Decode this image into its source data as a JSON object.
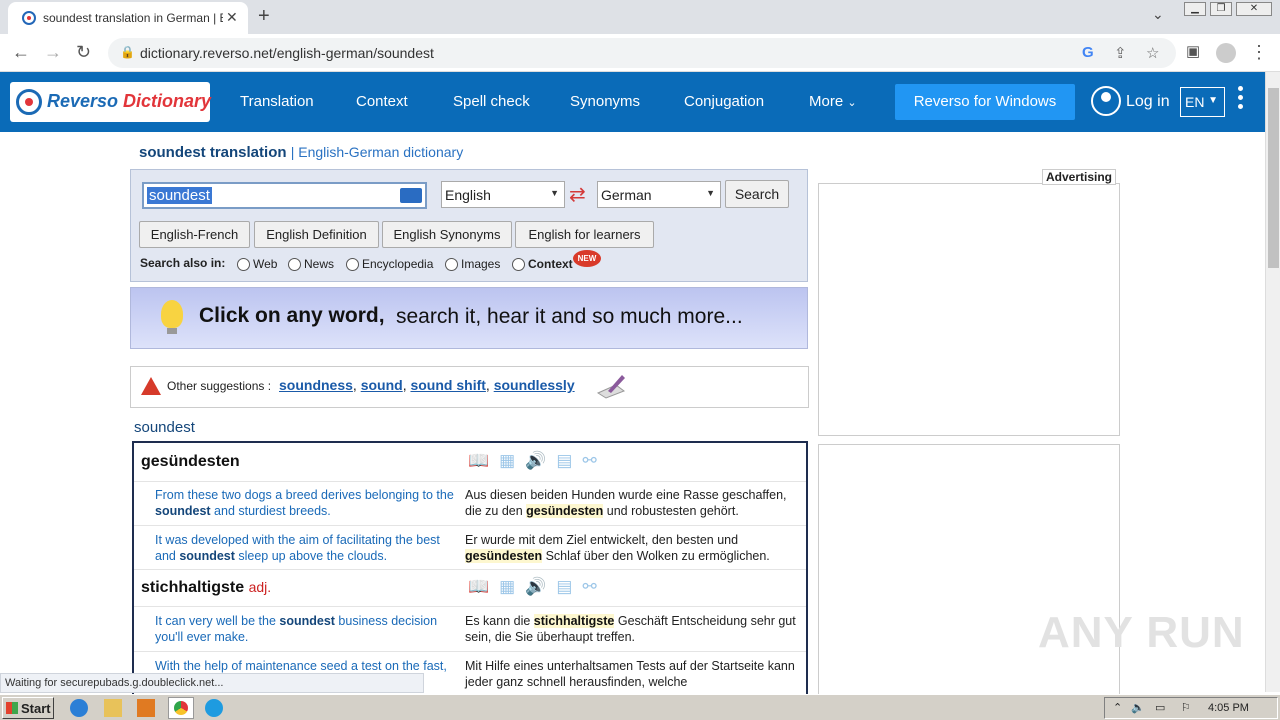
{
  "browser": {
    "tab_title": "soundest translation in German | English",
    "url": "dictionary.reverso.net/english-german/soundest",
    "new_tab_symbol": "+",
    "tab_close_symbol": "✕"
  },
  "site": {
    "logo_part1": "Reverso",
    "logo_part2": "Dictionary",
    "nav": [
      "Translation",
      "Context",
      "Spell check",
      "Synonyms",
      "Conjugation",
      "More"
    ],
    "windows_button": "Reverso for Windows",
    "login": "Log in",
    "language": "EN"
  },
  "page": {
    "title_word": "soundest translation",
    "title_sub": "| English-German dictionary",
    "search_value": "soundest",
    "source_lang": "English",
    "target_lang": "German",
    "search_button": "Search",
    "dict_buttons": [
      "English-French",
      "English Definition",
      "English Synonyms",
      "English for learners"
    ],
    "search_also_label": "Search also in:",
    "search_also": [
      "Web",
      "News",
      "Encyclopedia",
      "Images",
      "Context"
    ],
    "new_badge": "NEW",
    "banner_strong": "Click on any word,",
    "banner_rest": "search it,  hear it  and so much more...",
    "suggest_label": "Other suggestions :",
    "suggestions": [
      "soundness",
      "sound",
      "sound shift",
      "soundlessly"
    ],
    "headword": "soundest"
  },
  "results": [
    {
      "translation": "gesündesten",
      "pos": "",
      "examples": [
        {
          "en_pre": "From these two dogs a breed derives belonging to the ",
          "en_hl": "soundest",
          "en_post": " and sturdiest breeds.",
          "de_pre": "Aus diesen beiden Hunden wurde eine Rasse geschaffen, die zu den ",
          "de_hl": "gesündesten",
          "de_post": " und robustesten gehört."
        },
        {
          "en_pre": "It was developed with the aim of facilitating the best and ",
          "en_hl": "soundest",
          "en_post": " sleep up above the clouds.",
          "de_pre": "Er wurde mit dem Ziel entwickelt, den besten und ",
          "de_hl": "gesündesten",
          "de_post": " Schlaf über den Wolken zu ermöglichen."
        }
      ]
    },
    {
      "translation": "stichhaltigste",
      "pos": "adj.",
      "examples": [
        {
          "en_pre": "It can very well be the ",
          "en_hl": "soundest",
          "en_post": " business decision you'll ever make.",
          "de_pre": "Es kann die ",
          "de_hl": "stichhaltigste",
          "de_post": " Geschäft Entscheidung sehr gut sein, die Sie überhaupt treffen."
        },
        {
          "en_pre": "With the help of maintenance seed a test on the ",
          "en_hl": "",
          "en_post": "fast,",
          "de_pre": "Mit Hilfe eines unterhaltsamen Tests auf der Startseite kann jeder ganz schnell herausfinden, welche",
          "de_hl": "",
          "de_post": ""
        }
      ]
    }
  ],
  "ads": {
    "label": "Advertising"
  },
  "watermark": "ANY RUN",
  "status": "Waiting for securepubads.g.doubleclick.net...",
  "taskbar": {
    "start": "Start",
    "clock": "4:05 PM"
  }
}
